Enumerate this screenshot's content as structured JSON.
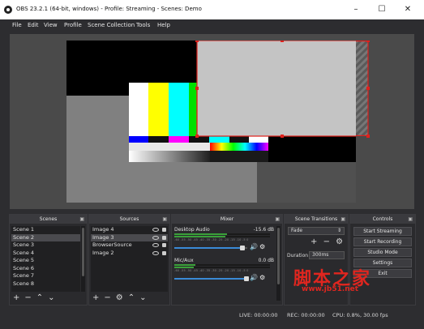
{
  "window": {
    "title": "OBS 23.2.1 (64-bit, windows) - Profile: Streaming - Scenes: Demo"
  },
  "menu": [
    "File",
    "Edit",
    "View",
    "Profile",
    "Scene Collection",
    "Tools",
    "Help"
  ],
  "docks": {
    "scenes": {
      "title": "Scenes",
      "items": [
        "Scene 1",
        "Scene 2",
        "Scene 3",
        "Scene 4",
        "Scene 5",
        "Scene 6",
        "Scene 7",
        "Scene 8"
      ],
      "selected_index": 1
    },
    "sources": {
      "title": "Sources",
      "items": [
        "Image 4",
        "Image 3",
        "BrowserSource",
        "Image 2"
      ],
      "selected_index": 1
    },
    "mixer": {
      "title": "Mixer",
      "channels": [
        {
          "name": "Desktop Audio",
          "db": "-15.6 dB",
          "level": 0.55,
          "volume": 0.72
        },
        {
          "name": "Mic/Aux",
          "db": "0.0 dB",
          "level": 0.22,
          "volume": 1.0
        }
      ],
      "ticks": "-60 -55 -50 -45 -40 -35 -30 -25 -20 -15 -10 -5 0"
    },
    "transitions": {
      "title": "Scene Transitions",
      "selected": "Fade",
      "duration_label": "Duration",
      "duration_value": "300ms"
    },
    "controls": {
      "title": "Controls",
      "buttons": [
        "Start Streaming",
        "Start Recording",
        "Studio Mode",
        "Settings",
        "Exit"
      ]
    }
  },
  "status": {
    "live": "LIVE: 00:00:00",
    "rec": "REC: 00:00:00",
    "cpu": "CPU: 0.8%, 30.00 fps"
  },
  "watermark": {
    "brand": "脚本之家",
    "url": "www.jb51.net"
  },
  "colors": {
    "selection": "#e0201c",
    "bars": [
      "#c0c0c0",
      "#c0c000",
      "#00c0c0",
      "#00c000",
      "#c000c0",
      "#c00000",
      "#0000c0"
    ]
  }
}
